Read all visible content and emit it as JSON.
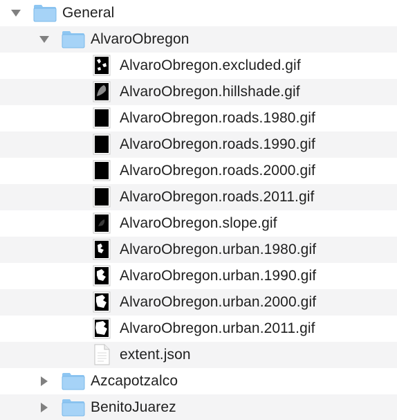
{
  "tree": {
    "root": {
      "label": "General",
      "icon": "folder-icon",
      "expanded": true,
      "children": [
        {
          "label": "AlvaroObregon",
          "icon": "folder-icon",
          "expanded": true,
          "children": [
            {
              "label": "AlvaroObregon.excluded.gif",
              "icon": "gif-thumbnail-icon",
              "thumb": "excluded"
            },
            {
              "label": "AlvaroObregon.hillshade.gif",
              "icon": "gif-thumbnail-icon",
              "thumb": "hillshade"
            },
            {
              "label": "AlvaroObregon.roads.1980.gif",
              "icon": "gif-thumbnail-icon",
              "thumb": "roads"
            },
            {
              "label": "AlvaroObregon.roads.1990.gif",
              "icon": "gif-thumbnail-icon",
              "thumb": "roads"
            },
            {
              "label": "AlvaroObregon.roads.2000.gif",
              "icon": "gif-thumbnail-icon",
              "thumb": "roads"
            },
            {
              "label": "AlvaroObregon.roads.2011.gif",
              "icon": "gif-thumbnail-icon",
              "thumb": "roads"
            },
            {
              "label": "AlvaroObregon.slope.gif",
              "icon": "gif-thumbnail-icon",
              "thumb": "slope"
            },
            {
              "label": "AlvaroObregon.urban.1980.gif",
              "icon": "gif-thumbnail-icon",
              "thumb": "urban"
            },
            {
              "label": "AlvaroObregon.urban.1990.gif",
              "icon": "gif-thumbnail-icon",
              "thumb": "urban"
            },
            {
              "label": "AlvaroObregon.urban.2000.gif",
              "icon": "gif-thumbnail-icon",
              "thumb": "urban"
            },
            {
              "label": "AlvaroObregon.urban.2011.gif",
              "icon": "gif-thumbnail-icon",
              "thumb": "urban"
            },
            {
              "label": "extent.json",
              "icon": "json-document-icon",
              "thumb": "document"
            }
          ]
        },
        {
          "label": "Azcapotzalco",
          "icon": "folder-icon",
          "expanded": false
        },
        {
          "label": "BenitoJuarez",
          "icon": "folder-icon",
          "expanded": false
        }
      ]
    }
  },
  "colors": {
    "folder_body": "#a6d3f7",
    "folder_tab": "#8ec6f2",
    "folder_edge": "#7ab8ea",
    "row_alt": "#f4f4f5",
    "disclosure": "#808080",
    "text": "#1f1f1f"
  }
}
